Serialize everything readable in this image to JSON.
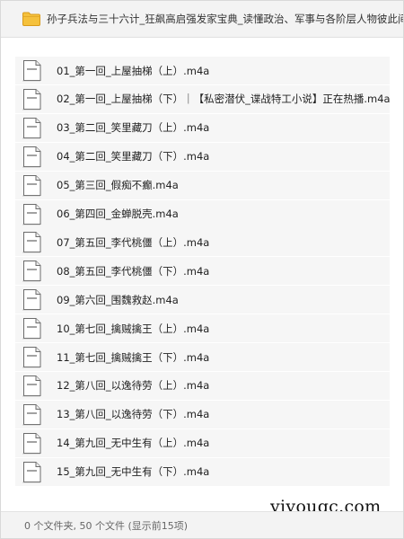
{
  "header": {
    "title": "孙子兵法与三十六计_狂飙高启强发家宝典_读懂政治、军事与各阶层人物彼此间的谋略",
    "icon": "folder-icon"
  },
  "files": [
    {
      "name": "01_第一回_上屋抽梯（上）.m4a",
      "icon": "file-icon"
    },
    {
      "name": "02_第一回_上屋抽梯（下）｜【私密潜伏_谍战特工小说】正在热播.m4a",
      "icon": "file-icon"
    },
    {
      "name": "03_第二回_笑里藏刀（上）.m4a",
      "icon": "file-icon"
    },
    {
      "name": "04_第二回_笑里藏刀（下）.m4a",
      "icon": "file-icon"
    },
    {
      "name": "05_第三回_假痴不癫.m4a",
      "icon": "file-icon"
    },
    {
      "name": "06_第四回_金蝉脱壳.m4a",
      "icon": "file-icon"
    },
    {
      "name": "07_第五回_李代桃僵（上）.m4a",
      "icon": "file-icon"
    },
    {
      "name": "08_第五回_李代桃僵（下）.m4a",
      "icon": "file-icon"
    },
    {
      "name": "09_第六回_围魏救赵.m4a",
      "icon": "file-icon"
    },
    {
      "name": "10_第七回_擒贼擒王（上）.m4a",
      "icon": "file-icon"
    },
    {
      "name": "11_第七回_擒贼擒王（下）.m4a",
      "icon": "file-icon"
    },
    {
      "name": "12_第八回_以逸待劳（上）.m4a",
      "icon": "file-icon"
    },
    {
      "name": "13_第八回_以逸待劳（下）.m4a",
      "icon": "file-icon"
    },
    {
      "name": "14_第九回_无中生有（上）.m4a",
      "icon": "file-icon"
    },
    {
      "name": "15_第九回_无中生有（下）.m4a",
      "icon": "file-icon"
    }
  ],
  "watermark": "yiyouqc.com",
  "footer": {
    "status": "0 个文件夹, 50 个文件 (显示前15项)"
  },
  "colors": {
    "header_bg": "#f3f3f3",
    "row_bg": "#f6f6f6",
    "folder_yellow": "#f5c13c",
    "text": "#222222"
  }
}
